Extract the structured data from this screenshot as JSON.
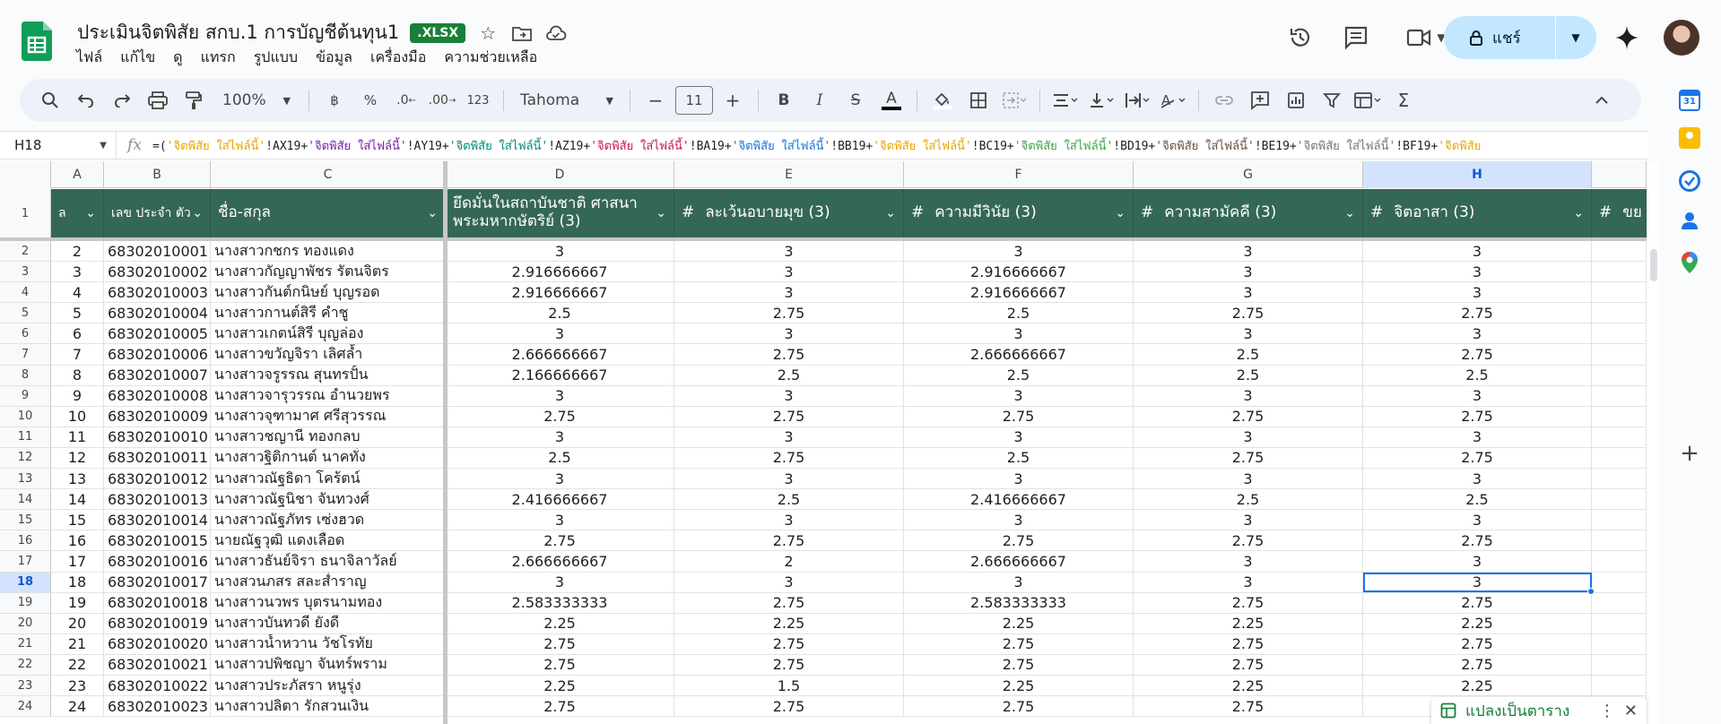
{
  "app": {
    "doc_title": "ประเมินจิตพิสัย สกบ.1 การบัญชีต้นทุน1",
    "file_badge": ".XLSX",
    "menu": [
      "ไฟล์",
      "แก้ไข",
      "ดู",
      "แทรก",
      "รูปแบบ",
      "ข้อมูล",
      "เครื่องมือ",
      "ความช่วยเหลือ"
    ],
    "share_label": "แชร์",
    "brand_color": "#188038",
    "header_fill": "#356854"
  },
  "toolbar": {
    "zoom": "100%",
    "currency": "฿",
    "percent": "%",
    "dec_decrease": ".0",
    "dec_increase": ".00",
    "format_123": "123",
    "font": "Tahoma",
    "font_size": "11",
    "bold": "B",
    "italic": "I",
    "strike": "S",
    "text_color": "A"
  },
  "formula_bar": {
    "cell_ref": "H18",
    "fx": "fx",
    "formula": "=('จิตพิสัย ใส่ไฟล์นี้'!AX19+'จิตพิสัย ใส่ไฟล์นี้'!AY19+'จิตพิสัย ใส่ไฟล์นี้'!AZ19+'จิตพิสัย ใส่ไฟล์นี้'!BA19+'จิตพิสัย ใส่ไฟล์นี้'!BB19+'จิตพิสัย ใส่ไฟล์นี้'!BC19+'จิตพิสัย ใส่ไฟล์นี้'!BD19+'จิตพิสัย ใส่ไฟล์นี้'!BE19+'จิตพิสัย ใส่ไฟล์นี้'!BF19+'จิตพิสัย"
  },
  "grid": {
    "columns": [
      "A",
      "B",
      "C",
      "D",
      "E",
      "F",
      "G",
      "H",
      ""
    ],
    "selected_col": "H",
    "selected_row": "18",
    "header_row": {
      "num": "1",
      "a": "ล",
      "b": "เลข ประจำ ตัว",
      "c": "ชื่อ-สกุล",
      "d": "ยึดมั่นในสถาบันชาติ ศาสนา พระมหากษัตริย์ (3)",
      "e": "ละเว้นอบายมุข (3)",
      "f": "ความมีวินัย (3)",
      "g": "ความสามัคคี (3)",
      "h": "จิตอาสา (3)",
      "i": "ขย"
    },
    "rows": [
      {
        "r": "2",
        "a": "2",
        "b": "68302010001",
        "c": "นางสาวกชกร   ทองแดง",
        "d": "3",
        "e": "3",
        "f": "3",
        "g": "3",
        "h": "3"
      },
      {
        "r": "3",
        "a": "3",
        "b": "68302010002",
        "c": "นางสาวกัญญาพัชร  รัตนจิตร",
        "d": "2.916666667",
        "e": "3",
        "f": "2.916666667",
        "g": "3",
        "h": "3"
      },
      {
        "r": "4",
        "a": "4",
        "b": "68302010003",
        "c": "นางสาวกันต์กนิษย์  บุญรอด",
        "d": "2.916666667",
        "e": "3",
        "f": "2.916666667",
        "g": "3",
        "h": "3"
      },
      {
        "r": "5",
        "a": "5",
        "b": "68302010004",
        "c": "นางสาวกานต์สิรี       คำชู",
        "d": "2.5",
        "e": "2.75",
        "f": "2.5",
        "g": "2.75",
        "h": "2.75"
      },
      {
        "r": "6",
        "a": "6",
        "b": "68302010005",
        "c": "นางสาวเกตน์สิรี       บุญล่อง",
        "d": "3",
        "e": "3",
        "f": "3",
        "g": "3",
        "h": "3"
      },
      {
        "r": "7",
        "a": "7",
        "b": "68302010006",
        "c": "นางสาวขวัญจิรา       เลิศล้ำ",
        "d": "2.666666667",
        "e": "2.75",
        "f": "2.666666667",
        "g": "2.5",
        "h": "2.75"
      },
      {
        "r": "8",
        "a": "8",
        "b": "68302010007",
        "c": "นางสาวจรูรรณ     สุนทรปั้น",
        "d": "2.166666667",
        "e": "2.5",
        "f": "2.5",
        "g": "2.5",
        "h": "2.5"
      },
      {
        "r": "9",
        "a": "9",
        "b": "68302010008",
        "c": "นางสาวจารุวรรณ      อำนวยพร",
        "d": "3",
        "e": "3",
        "f": "3",
        "g": "3",
        "h": "3"
      },
      {
        "r": "10",
        "a": "10",
        "b": "68302010009",
        "c": "นางสาวจุฑามาศ      ศรีสุวรรณ",
        "d": "2.75",
        "e": "2.75",
        "f": "2.75",
        "g": "2.75",
        "h": "2.75"
      },
      {
        "r": "11",
        "a": "11",
        "b": "68302010010",
        "c": "นางสาวชญานี          ทองกลบ",
        "d": "3",
        "e": "3",
        "f": "3",
        "g": "3",
        "h": "3"
      },
      {
        "r": "12",
        "a": "12",
        "b": "68302010011",
        "c": "นางสาวฐิติกานต์       นาคทั่ง",
        "d": "2.5",
        "e": "2.75",
        "f": "2.5",
        "g": "2.75",
        "h": "2.75"
      },
      {
        "r": "13",
        "a": "13",
        "b": "68302010012",
        "c": "นางสาวณัฐธิดา        โคร้ตน์",
        "d": "3",
        "e": "3",
        "f": "3",
        "g": "3",
        "h": "3"
      },
      {
        "r": "14",
        "a": "14",
        "b": "68302010013",
        "c": "นางสาวณัฐนิชา        จันทวงศ์",
        "d": "2.416666667",
        "e": "2.5",
        "f": "2.416666667",
        "g": "2.5",
        "h": "2.5"
      },
      {
        "r": "15",
        "a": "15",
        "b": "68302010014",
        "c": "นางสาวณัฐภัทร        เซ่งฮวด",
        "d": "3",
        "e": "3",
        "f": "3",
        "g": "3",
        "h": "3"
      },
      {
        "r": "16",
        "a": "16",
        "b": "68302010015",
        "c": "นายณัฐวุฒิ           แดงเลือด",
        "d": "2.75",
        "e": "2.75",
        "f": "2.75",
        "g": "2.75",
        "h": "2.75"
      },
      {
        "r": "17",
        "a": "17",
        "b": "68302010016",
        "c": "นางสาวธันย์จิรา    ธนาจิลาวัลย์",
        "d": "2.666666667",
        "e": "2",
        "f": "2.666666667",
        "g": "3",
        "h": "3"
      },
      {
        "r": "18",
        "a": "18",
        "b": "68302010017",
        "c": "นางสวนภสร    สละส่ำราญ",
        "d": "3",
        "e": "3",
        "f": "3",
        "g": "3",
        "h": "3"
      },
      {
        "r": "19",
        "a": "19",
        "b": "68302010018",
        "c": "นางสาวนวพร      บุตรนามทอง",
        "d": "2.583333333",
        "e": "2.75",
        "f": "2.583333333",
        "g": "2.75",
        "h": "2.75"
      },
      {
        "r": "20",
        "a": "20",
        "b": "68302010019",
        "c": "นางสาวบันทวดี    ยังดี",
        "d": "2.25",
        "e": "2.25",
        "f": "2.25",
        "g": "2.25",
        "h": "2.25"
      },
      {
        "r": "21",
        "a": "21",
        "b": "68302010020",
        "c": "นางสาวน้ำหวาน   วัชโรทัย",
        "d": "2.75",
        "e": "2.75",
        "f": "2.75",
        "g": "2.75",
        "h": "2.75"
      },
      {
        "r": "22",
        "a": "22",
        "b": "68302010021",
        "c": "นางสาวปพิชญา    จันทร์พราม",
        "d": "2.75",
        "e": "2.75",
        "f": "2.75",
        "g": "2.75",
        "h": "2.75"
      },
      {
        "r": "23",
        "a": "23",
        "b": "68302010022",
        "c": "นางสาวประภัสรา  หนูรุ่ง",
        "d": "2.25",
        "e": "1.5",
        "f": "2.25",
        "g": "2.25",
        "h": "2.25"
      },
      {
        "r": "24",
        "a": "24",
        "b": "68302010023",
        "c": "นางสาวปลิตา     รักสวนเงิน",
        "d": "2.75",
        "e": "2.75",
        "f": "2.75",
        "g": "2.75",
        "h": ""
      }
    ]
  },
  "toast": {
    "label": "แปลงเป็นตาราง"
  }
}
